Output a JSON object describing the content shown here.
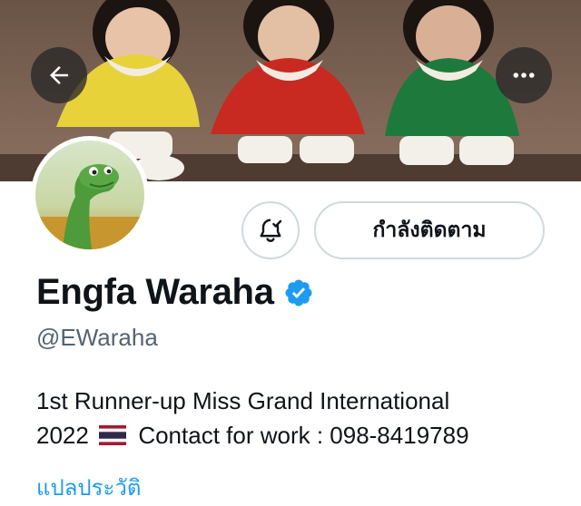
{
  "header": {
    "back_icon": "arrow-left-icon",
    "more_icon": "more-horizontal-icon"
  },
  "profile": {
    "display_name": "Engfa Waraha",
    "verified": true,
    "handle": "@EWaraha",
    "bio_line1": "1st Runner-up Miss Grand International",
    "bio_line2_prefix": "2022",
    "bio_flag": "thailand-flag-icon",
    "bio_line2_suffix": "Contact for work : 098-8419789",
    "translate_link": "แปลประวัติ"
  },
  "actions": {
    "notify_icon": "bell-check-icon",
    "follow_label": "กำลังติดตาม"
  },
  "colors": {
    "accent": "#1d9bf0",
    "secondary_text": "#536471",
    "border": "#cfd9de"
  }
}
